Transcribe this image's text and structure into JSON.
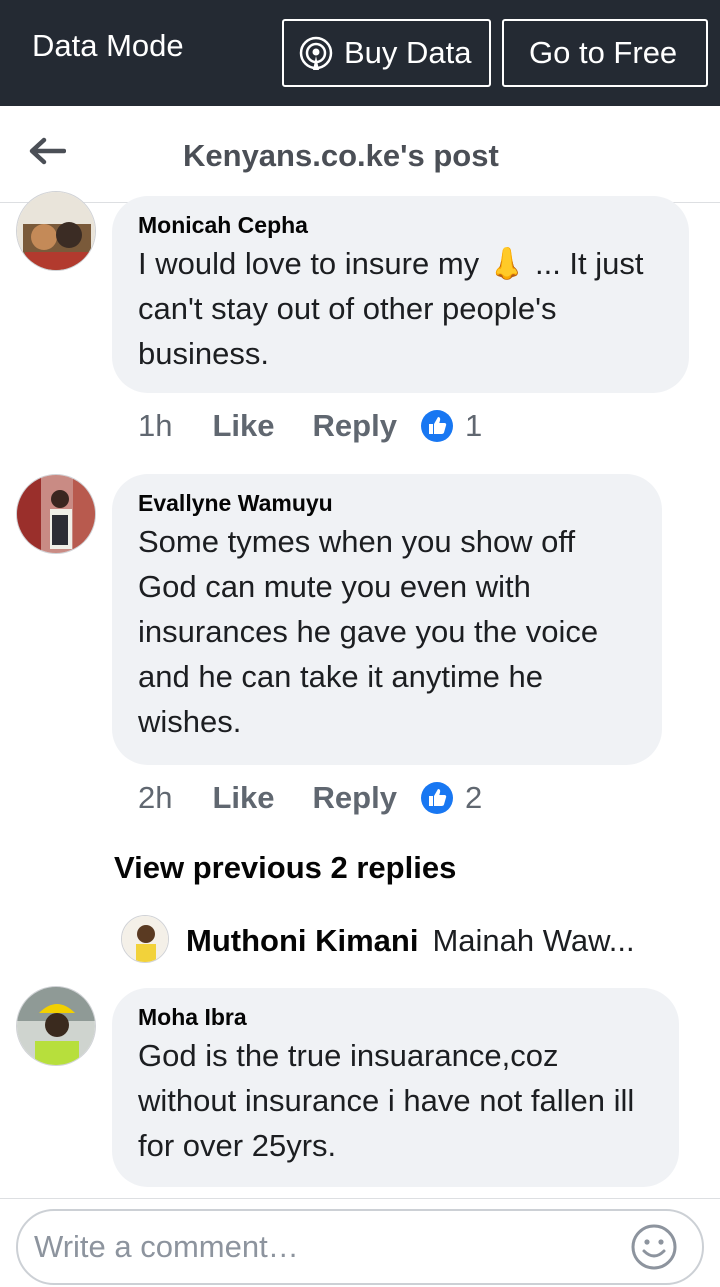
{
  "topbar": {
    "mode_label": "Data Mode",
    "buy_label": "Buy Data",
    "free_label": "Go to Free"
  },
  "header": {
    "title": "Kenyans.co.ke's post"
  },
  "comments": [
    {
      "name": "Monicah Cepha",
      "text": "I would love to insure my 👃 ... It just can't stay out of other people's business.",
      "time": "1h",
      "like_label": "Like",
      "reply_label": "Reply",
      "reactions": "1"
    },
    {
      "name": "Evallyne Wamuyu",
      "text": "Some tymes when you show off God can mute you even with insurances he gave you the voice and he can take it anytime he wishes.",
      "time": "2h",
      "like_label": "Like",
      "reply_label": "Reply",
      "reactions": "2"
    },
    {
      "name": "Moha Ibra",
      "text": "God is the true insuarance,coz without insurance i have not fallen ill for over  25yrs."
    }
  ],
  "replies": {
    "view_previous_label": "View previous 2 replies",
    "preview_name": "Muthoni Kimani",
    "preview_text": "Mainah Waw..."
  },
  "composer": {
    "placeholder": "Write a comment…"
  },
  "colors": {
    "topbar_bg": "#242a33",
    "bubble_bg": "#f0f2f5",
    "like_blue": "#1877f2",
    "meta_gray": "#606770"
  },
  "icons": {
    "buy": "broadcast-icon",
    "back": "arrow-left-icon",
    "reaction": "thumbs-up-icon",
    "emoji": "smiley-icon"
  }
}
